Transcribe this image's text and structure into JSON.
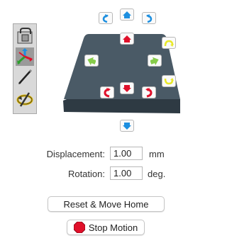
{
  "tools": [
    {
      "icon": "selection-tool-icon"
    },
    {
      "icon": "move-axes-tool-icon"
    },
    {
      "icon": "pen-tool-icon"
    },
    {
      "icon": "rotate-tool-icon"
    }
  ],
  "arrows": {
    "top_row": [
      "rotate-ccw-icon",
      "arrow-up-icon",
      "rotate-cw-icon"
    ],
    "plate": [
      "arrow-up-icon",
      "rotate-cw-small-icon",
      "arrow-left-icon",
      "arrow-right-icon",
      "rotate-ccw-small-icon",
      "rotate-ccw-icon",
      "arrow-down-icon",
      "rotate-cw-icon"
    ],
    "bottom": "arrow-down-icon"
  },
  "colors": {
    "plate_top": "#4a5a66",
    "plate_side": "#2e3a43",
    "red": "#e0102a",
    "blue": "#1d8fe0",
    "green": "#86cc4a",
    "yellow": "#e9e92a"
  },
  "displacement": {
    "label": "Displacement:",
    "value": "1.00",
    "unit": "mm"
  },
  "rotation": {
    "label": "Rotation:",
    "value": "1.00",
    "unit": "deg."
  },
  "reset_label": "Reset & Move Home",
  "stop_label": "Stop Motion"
}
